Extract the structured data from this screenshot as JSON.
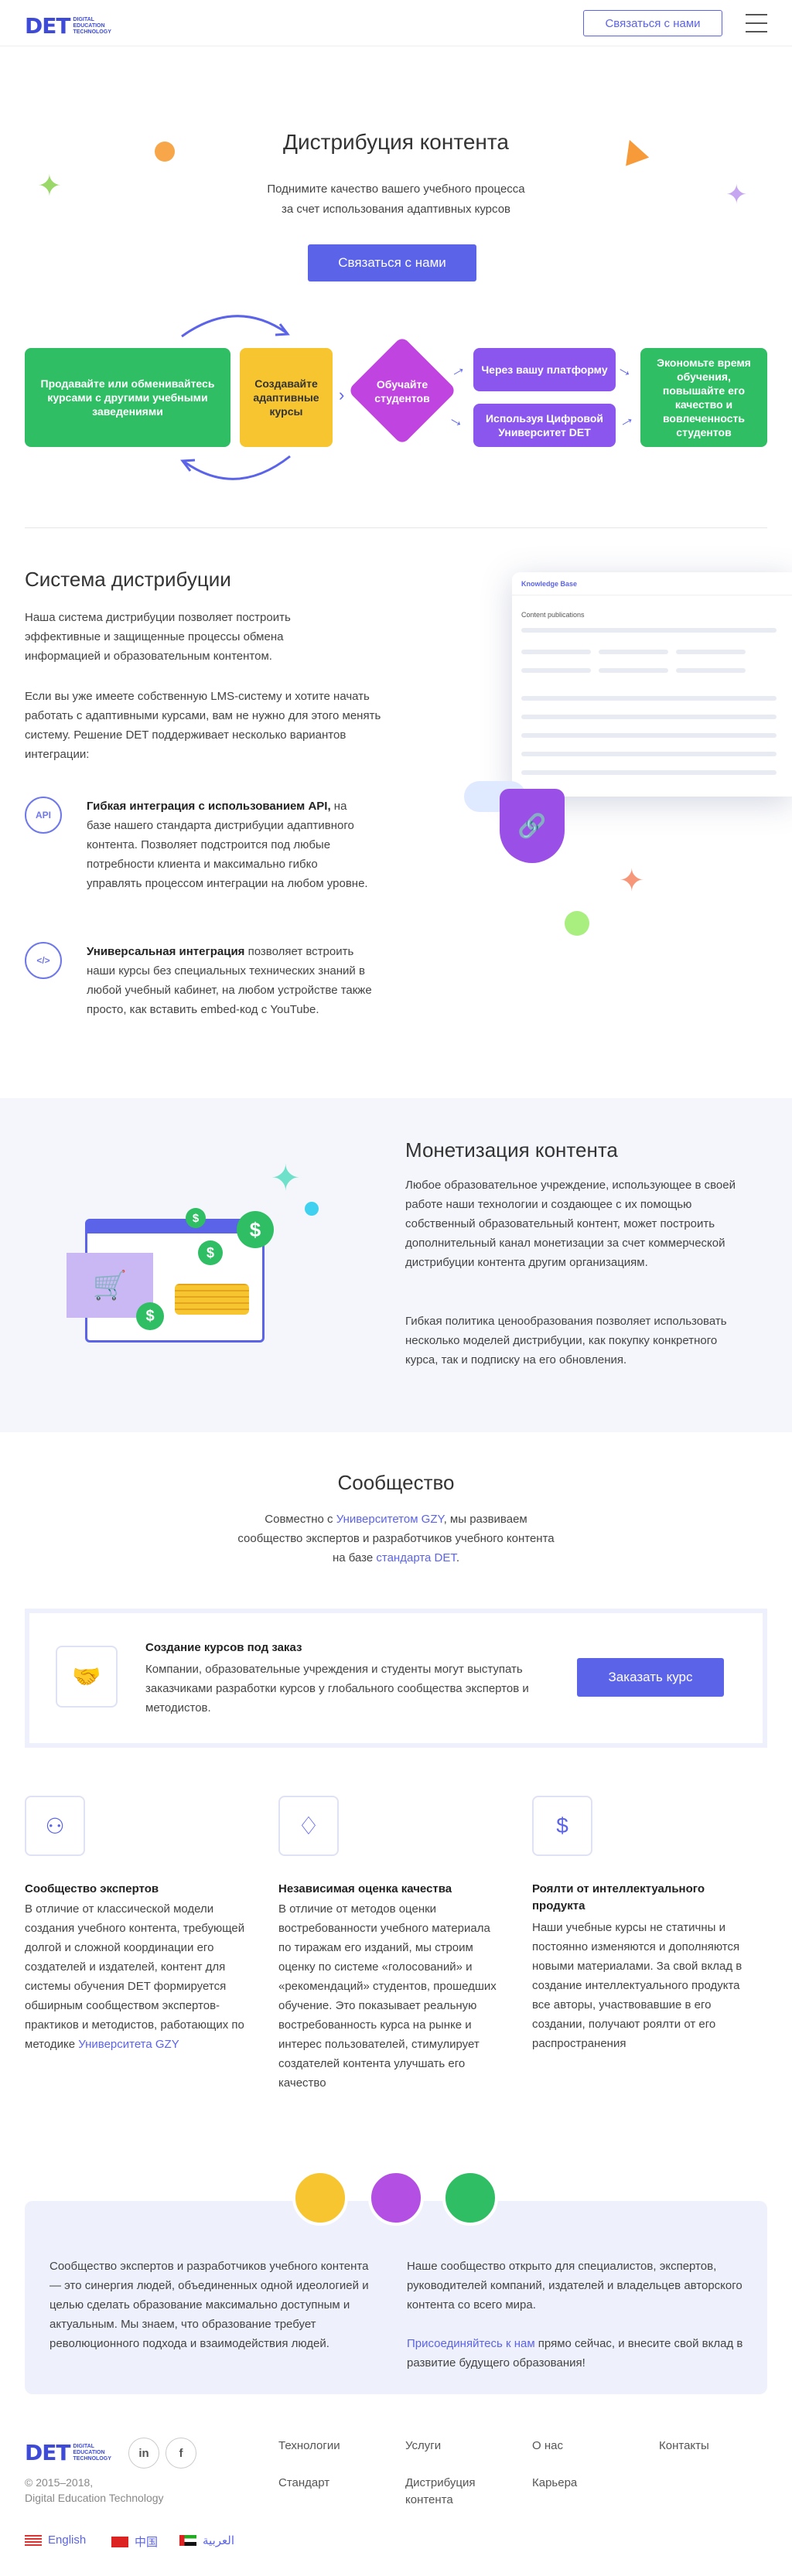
{
  "header": {
    "logo": "DET",
    "logo_sub_1": "DIGITAL",
    "logo_sub_2": "EDUCATION",
    "logo_sub_3": "TECHNOLOGY",
    "contact_btn": "Связаться с нами"
  },
  "hero": {
    "title": "Дистрибуция контента",
    "subtitle_1": "Поднимите качество вашего учебного процесса",
    "subtitle_2": "за счет использования адаптивных курсов",
    "cta": "Связаться с нами"
  },
  "flow": {
    "box1": "Продавайте или обменивайтесь курсами с другими учебными заведениями",
    "box2": "Создавайте адаптивные курсы",
    "box3": "Обучайте студентов",
    "box4": "Через вашу платформу",
    "box5": "Используя Цифровой Университет DET",
    "box6": "Экономьте время обучения, повышайте его качество и вовлеченность студентов"
  },
  "distribution": {
    "title": "Система дистрибуции",
    "p1": "Наша система дистрибуции позволяет построить эффективные и защищенные процессы обмена информацией и образовательным контентом.",
    "p2": "Если вы уже имеете собственную LMS-систему и хотите начать работать с адаптивными курсами, вам не нужно для этого менять систему. Решение DET поддерживает несколько вариантов интеграции:",
    "api_label": "API",
    "api_bold": "Гибкая интеграция с использованием API,",
    "api_text": "на базе нашего стандарта дистрибуции адаптивного контента. Позволяет подстроится под любые потребности клиента и максимально гибко управлять процессом интеграции на любом уровне.",
    "uni_label": "</>",
    "uni_bold": "Универсальная интеграция",
    "uni_text": "позволяет встроить наши курсы без специальных технических знаний в любой учебный кабинет, на любом устройстве также просто, как вставить embed-код с YouTube.",
    "mock_title": "Knowledge Base",
    "mock_heading": "Content publications"
  },
  "monetization": {
    "title": "Монетизация контента",
    "p1": "Любое образовательное учреждение, использующее в своей работе наши технологии и создающее с их помощью собственный образовательный контент, может построить дополнительный канал монетизации за счет коммерческой дистрибуции контента другим организациям.",
    "p2": "Гибкая политика ценообразования позволяет использовать несколько моделей дистрибуции, как покупку конкретного курса, так и подписку на его обновления.",
    "dollar": "$",
    "cart": "🛒"
  },
  "community": {
    "title": "Сообщество",
    "intro_a": "Совместно с ",
    "intro_link1": "Университетом GZY",
    "intro_b": ", мы развиваем сообщество экспертов и разработчиков учебного контента на базе ",
    "intro_link2": "стандарта DET",
    "intro_c": ".",
    "order_title": "Создание курсов под заказ",
    "order_text": "Компании, образовательные учреждения и студенты могут выступать заказчиками разработки курсов у глобального сообщества экспертов и методистов.",
    "order_btn": "Заказать курс",
    "col1_title": "Сообщество экспертов",
    "col1_text": "В отличие от классической модели создания учебного контента, требующей долгой и сложной координации его создателей и издателей, контент для системы обучения DET формируется обширным сообществом экспертов-практиков и методистов, работающих по методике ",
    "col1_link": "Университета GZY",
    "col2_title": "Независимая оценка качества",
    "col2_text": "В отличие от методов оценки востребованности учебного материала по тиражам его изданий, мы строим оценку по системе «голосований» и «рекомендаций» студентов, прошедших обучение. Это показывает реальную востребованность курса на рынке и интерес пользователей, стимулирует создателей контента улучшать его качество",
    "col3_title": "Роялти от интеллектуального продукта",
    "col3_text": "Наши учебные курсы не статичны и постоянно изменяются и дополняются новыми материалами. За свой вклад в создание интеллектуального продукта все авторы, участвовавшие в его создании, получают роялти от его распространения"
  },
  "join": {
    "left": "Сообщество экспертов и разработчиков учебного контента — это синергия людей, объединенных одной идеологией и целью сделать образование максимально доступным и актуальным. Мы знаем, что образование требует революционного подхода и взаимодействия людей.",
    "right": "Наше сообщество открыто для специалистов, экспертов, руководителей компаний, издателей и владельцев авторского контента со всего мира.",
    "link": "Присоединяйтесь к нам",
    "right2": " прямо сейчас, и внесите свой вклад в развитие будущего образования!"
  },
  "footer": {
    "logo": "DET",
    "copyright_1": "© 2015–2018,",
    "copyright_2": "Digital Education Technology",
    "linkedin": "in",
    "facebook": "f",
    "links": [
      "Технологии",
      "Услуги",
      "О нас",
      "Контакты",
      "Стандарт",
      "Дистрибуция контента",
      "Карьера"
    ],
    "lang_en": "English",
    "lang_cn": "中国",
    "lang_ar": "العربية"
  }
}
